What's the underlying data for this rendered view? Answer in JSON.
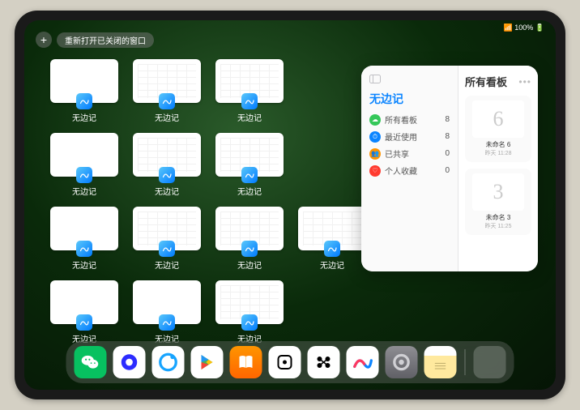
{
  "status": {
    "time": "",
    "right": "📶 100% 🔋"
  },
  "top": {
    "plus": "+",
    "reopen": "重新打开已关闭的窗口"
  },
  "app_label": "无边记",
  "thumbs": [
    {
      "variant": "blank"
    },
    {
      "variant": "calendar"
    },
    {
      "variant": "calendar"
    },
    {
      "variant": "blank"
    },
    {
      "variant": "calendar"
    },
    {
      "variant": "calendar"
    },
    {
      "variant": "blank"
    },
    {
      "variant": "calendar"
    },
    {
      "variant": "calendar"
    },
    {
      "variant": "calendar"
    },
    {
      "variant": "blank"
    },
    {
      "variant": "blank"
    },
    {
      "variant": "calendar"
    }
  ],
  "panel": {
    "title": "无边记",
    "right_title": "所有看板",
    "items": [
      {
        "label": "所有看板",
        "count": 8,
        "color": "#34c759",
        "glyph": "☁"
      },
      {
        "label": "最近使用",
        "count": 8,
        "color": "#0a84ff",
        "glyph": "⏱"
      },
      {
        "label": "已共享",
        "count": 0,
        "color": "#ff9500",
        "glyph": "👥"
      },
      {
        "label": "个人收藏",
        "count": 0,
        "color": "#ff3b30",
        "glyph": "♡"
      }
    ],
    "boards": [
      {
        "doodle": "6",
        "name": "未命名 6",
        "sub": "昨天 11:28"
      },
      {
        "doodle": "3",
        "name": "未命名 3",
        "sub": "昨天 11:25"
      }
    ]
  },
  "dock": [
    {
      "name": "wechat",
      "cls": "di-wechat",
      "glyph": "✳"
    },
    {
      "name": "quark",
      "cls": "di-quark",
      "glyph": ""
    },
    {
      "name": "qqbrowser",
      "cls": "di-qq",
      "glyph": ""
    },
    {
      "name": "play",
      "cls": "di-play",
      "glyph": ""
    },
    {
      "name": "books",
      "cls": "di-books",
      "glyph": ""
    },
    {
      "name": "dice",
      "cls": "di-dice",
      "glyph": ""
    },
    {
      "name": "wm",
      "cls": "di-wm",
      "glyph": ""
    },
    {
      "name": "freeform",
      "cls": "di-freeform",
      "glyph": ""
    },
    {
      "name": "settings",
      "cls": "di-settings",
      "glyph": ""
    },
    {
      "name": "notes",
      "cls": "di-notes",
      "glyph": ""
    },
    {
      "name": "app-library",
      "cls": "di-apps",
      "glyph": ""
    }
  ]
}
